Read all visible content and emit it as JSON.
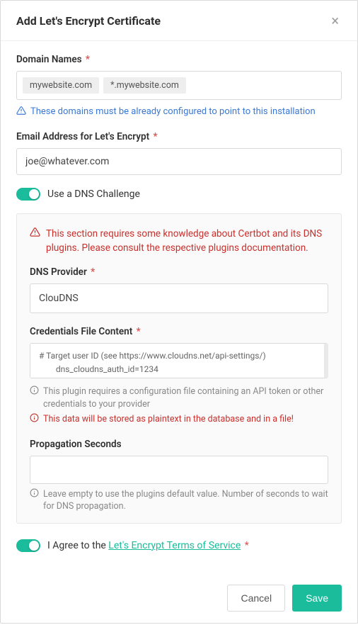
{
  "header": {
    "title": "Add Let's Encrypt Certificate"
  },
  "domain": {
    "label": "Domain Names",
    "tags": [
      "mywebsite.com",
      "*.mywebsite.com"
    ],
    "info": "These domains must be already configured to point to this installation"
  },
  "email": {
    "label": "Email Address for Let's Encrypt",
    "value": "joe@whatever.com"
  },
  "dns_toggle": {
    "label": "Use a DNS Challenge",
    "on": true
  },
  "dns_section": {
    "warning": "This section requires some knowledge about Certbot and its DNS plugins. Please consult the respective plugins documentation.",
    "provider_label": "DNS Provider",
    "provider_value": "ClouDNS",
    "creds_label": "Credentials File Content",
    "creds_value": "# Target user ID (see https://www.cloudns.net/api-settings/)\n        dns_cloudns_auth_id=1234",
    "creds_help": "This plugin requires a configuration file containing an API token or other credentials to your provider",
    "creds_danger": "This data will be stored as plaintext in the database and in a file!",
    "prop_label": "Propagation Seconds",
    "prop_help": "Leave empty to use the plugins default value. Number of seconds to wait for DNS propagation."
  },
  "agree": {
    "prefix": "I Agree to the ",
    "link": "Let's Encrypt Terms of Service",
    "on": true
  },
  "footer": {
    "cancel": "Cancel",
    "save": "Save"
  }
}
